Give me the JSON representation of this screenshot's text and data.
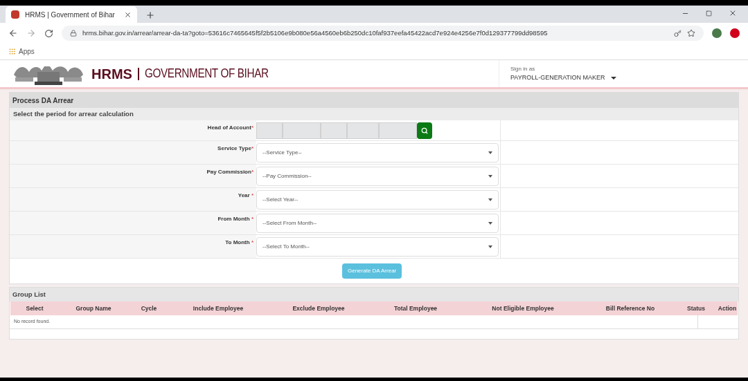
{
  "browser": {
    "tab_title": "HRMS | Government of Bihar",
    "url": "hrms.bihar.gov.in/arrear/arrear-da-ta?goto=53616c7465645f5f2b5106e9b080e56a4560eb6b250dc10faf937eefa45422acd7e924e4256e7f0d129377799dd98595",
    "bookmarks": [
      "Apps"
    ]
  },
  "header": {
    "brand": "HRMS",
    "brand_sub": "GOVERNMENT OF BIHAR",
    "sign_in_label": "Sign in as",
    "role": "PAYROLL-GENERATION MAKER"
  },
  "panel_title": "Process DA Arrear",
  "section_title": "Select the period for arrear calculation",
  "fields": [
    {
      "kind": "segments",
      "label": "Head of Account",
      "required_mark": "*"
    },
    {
      "kind": "select",
      "label": "Service Type",
      "required_mark": "*",
      "placeholder": "--Service Type--"
    },
    {
      "kind": "select",
      "label": "Pay Commission",
      "required_mark": "*",
      "placeholder": "--Pay Commission--"
    },
    {
      "kind": "select",
      "label": "Year ",
      "required_mark": "*",
      "placeholder": "--Select Year--"
    },
    {
      "kind": "select",
      "label": "From Month ",
      "required_mark": "*",
      "placeholder": "--Select From Month--"
    },
    {
      "kind": "select",
      "label": "To Month ",
      "required_mark": "*",
      "placeholder": "--Select To Month--"
    }
  ],
  "generate_button": "Generate DA Arrear",
  "group_list": {
    "title": "Group List",
    "columns": [
      "Select",
      "Group Name",
      "Cycle",
      "Include Employee",
      "Exclude Employee",
      "Total Employee",
      "Not Eligible Employee",
      "Bill Reference No",
      "Status",
      "Action"
    ],
    "empty_message": "No record found."
  }
}
